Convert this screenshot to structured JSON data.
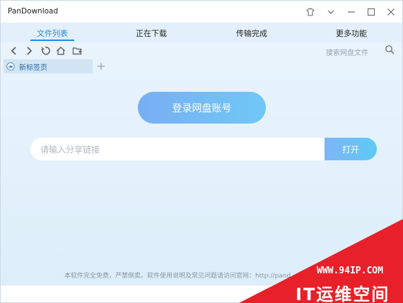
{
  "window": {
    "title": "PanDownload"
  },
  "tabs": [
    {
      "label": "文件列表",
      "active": true
    },
    {
      "label": "正在下载",
      "active": false
    },
    {
      "label": "传输完成",
      "active": false
    },
    {
      "label": "更多功能",
      "active": false
    }
  ],
  "toolbar": {
    "search_placeholder": "搜索网盘文件",
    "icons": [
      "back-icon",
      "forward-icon",
      "refresh-icon",
      "home-icon",
      "folder-icon",
      "search-icon"
    ]
  },
  "page_tab": {
    "label": "新标签页"
  },
  "main": {
    "login_label": "登录网盘账号",
    "share_placeholder": "请输入分享链接",
    "open_label": "打开"
  },
  "footer": {
    "text": "本软件完全免费，严禁倒卖。软件使用说明及常见问题请访问官网：http://pand"
  },
  "watermark": {
    "url": "WWW.94IP.COM",
    "brand": "IT运维空间"
  },
  "colors": {
    "accent": "#2b8bd8",
    "button_gradient_start": "#79aef4",
    "button_gradient_end": "#6fc8f6",
    "watermark_red": "#e8202a"
  }
}
